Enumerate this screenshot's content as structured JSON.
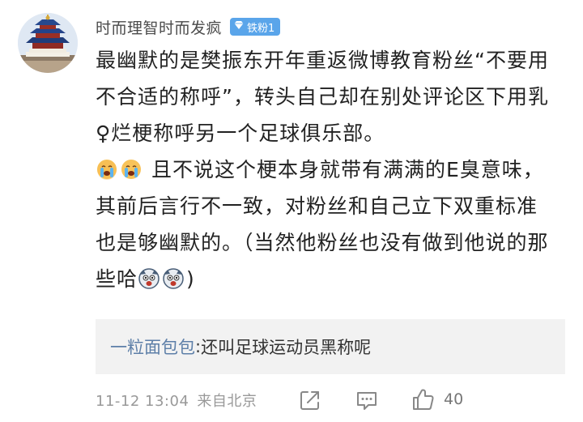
{
  "user": {
    "name": "时而理智时而发疯",
    "badge_label": "铁粉1"
  },
  "comment": {
    "para1": "最幽默的是樊振东开年重返微博教育粉丝“不要用不合适的称呼”，转头自己却在别处评论区下用乳♀烂梗称呼另一个足球俱乐部。",
    "para2_text": " 且不说这个梗本身就带有满满的E臭意味，其前后言行不一致，对粉丝和自己立下双重标准也是够幽默的。（当然他粉丝也没有做到他说的那些哈",
    "para2_end": ")",
    "emoji_before": "crying-face-emoji",
    "emoji_after": "dog-face-emoji"
  },
  "reply": {
    "author": "一粒面包包",
    "separator": ": ",
    "text": "还叫足球运动员黑称呢"
  },
  "meta": {
    "timestamp": "11-12 13:04",
    "source": "来自北京"
  },
  "actions": {
    "share_icon": "share-icon",
    "comment_icon": "comment-icon",
    "like_icon": "thumbs-up-icon",
    "like_count": "40"
  },
  "colors": {
    "badge": "#5aa5ea",
    "reply_author": "#5d7fa8",
    "reply_bg": "#f2f2f2",
    "meta_text": "#999999"
  }
}
